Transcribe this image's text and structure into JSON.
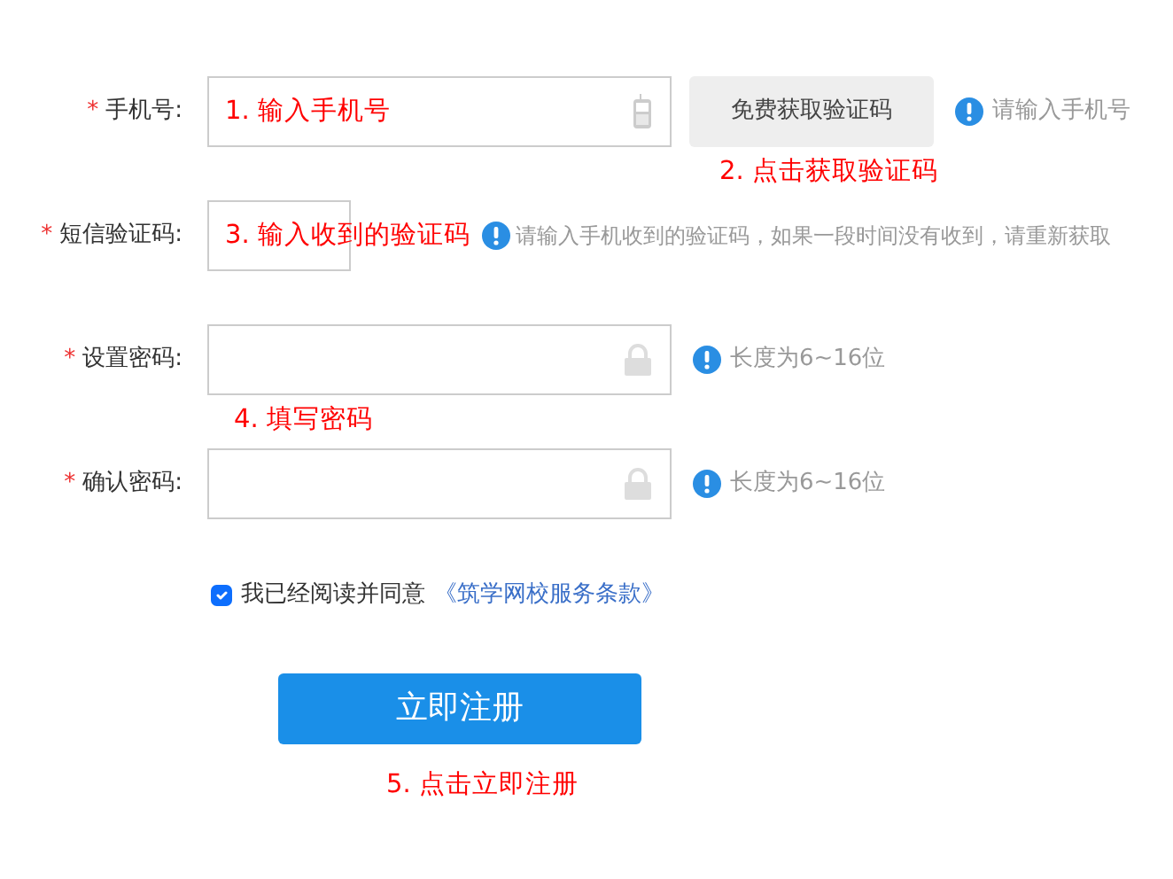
{
  "fields": [
    {
      "kind": "phone",
      "marker": "*",
      "label": "手机号:",
      "annotation": "1. 输入手机号",
      "button": "免费获取验证码",
      "button_annotation": "2. 点击获取验证码",
      "hint": "请输入手机号"
    },
    {
      "kind": "code",
      "marker": "*",
      "label": "短信验证码:",
      "annotation": "3. 输入收到的验证码",
      "hint": "请输入手机收到的验证码，如果一段时间没有收到，请重新获取"
    },
    {
      "kind": "password",
      "marker": "*",
      "label": "设置密码:",
      "hint": "长度为6~16位",
      "below_annotation": "4. 填写密码"
    },
    {
      "kind": "password",
      "marker": "*",
      "label": "确认密码:",
      "hint": "长度为6~16位"
    }
  ],
  "agreement": {
    "checked": true,
    "text": "我已经阅读并同意",
    "link": "《筑学网校服务条款》"
  },
  "submit": {
    "label": "立即注册",
    "annotation": "5. 点击立即注册"
  }
}
